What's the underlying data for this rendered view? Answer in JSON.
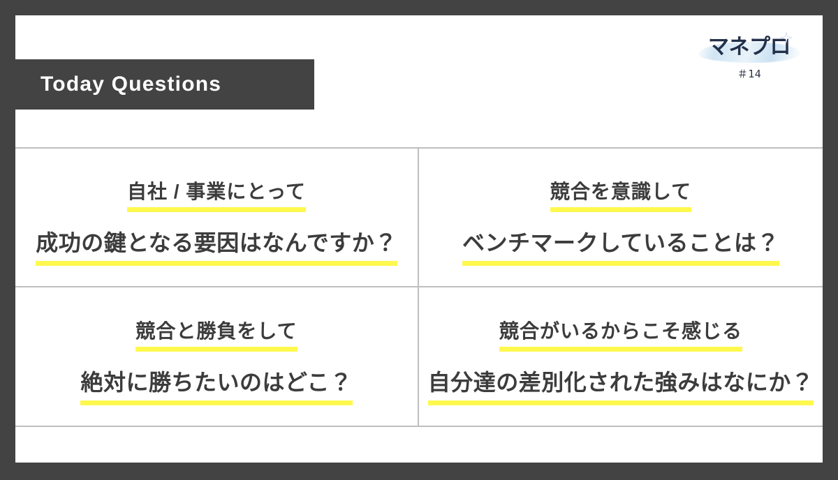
{
  "slide": {
    "header": {
      "title": "Today Questions"
    },
    "logo": {
      "brand": "マネプロ",
      "issue_number": "＃14",
      "brand_color": "#23304a",
      "swoosh_color": "#cde3f3"
    },
    "theme": {
      "frame_color": "#434343",
      "banner_color": "#434343",
      "canvas_color": "#ffffff",
      "grid_line_color": "#bfbfbf",
      "text_color": "#3c3c3c",
      "highlight_color": "#fff84d"
    },
    "questions": [
      {
        "id": "q1",
        "position": "top-left",
        "lead": "自社 / 事業にとって",
        "main": "成功の鍵となる要因はなんですか？"
      },
      {
        "id": "q2",
        "position": "top-right",
        "lead": "競合を意識して",
        "main": "ベンチマークしていることは？"
      },
      {
        "id": "q3",
        "position": "bottom-left",
        "lead": "競合と勝負をして",
        "main": "絶対に勝ちたいのはどこ？"
      },
      {
        "id": "q4",
        "position": "bottom-right",
        "lead": "競合がいるからこそ感じる",
        "main": "自分達の差別化された強みはなにか？"
      }
    ]
  }
}
